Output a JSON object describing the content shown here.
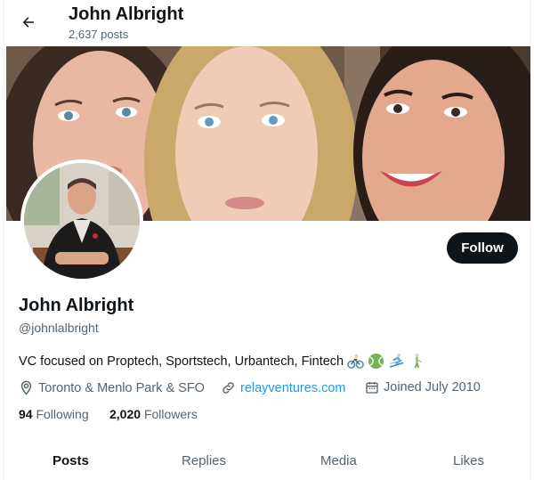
{
  "header": {
    "name": "John Albright",
    "posts_count": "2,637 posts"
  },
  "profile": {
    "name": "John Albright",
    "handle": "@johnlalbright",
    "bio": "VC focused on Proptech, Sportstech, Urbantech, Fintech",
    "bio_emojis": [
      "cyclist-icon",
      "tennis-ball-icon",
      "skier-icon",
      "golfer-icon"
    ],
    "location": "Toronto & Menlo Park & SFO",
    "website": "relayventures.com",
    "joined": "Joined July 2010",
    "following_count": "94",
    "following_label": "Following",
    "followers_count": "2,020",
    "followers_label": "Followers"
  },
  "actions": {
    "follow_label": "Follow"
  },
  "tabs": [
    {
      "label": "Posts",
      "active": true
    },
    {
      "label": "Replies",
      "active": false
    },
    {
      "label": "Media",
      "active": false
    },
    {
      "label": "Likes",
      "active": false
    }
  ],
  "colors": {
    "text_primary": "#0f1419",
    "text_secondary": "#536471",
    "link": "#1d9bf0",
    "button_bg": "#0f1419"
  }
}
